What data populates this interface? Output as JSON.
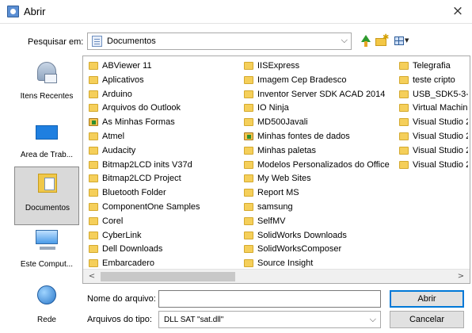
{
  "window": {
    "title": "Abrir",
    "close_glyph": "×",
    "icon": "java-app-icon"
  },
  "lookin": {
    "label": "Pesquisar em:",
    "value": "Documentos",
    "icon": "documents-folder-icon",
    "arrow": "⌵"
  },
  "toolbar": {
    "up_icon": "up-one-level-icon",
    "new_folder_icon": "new-folder-icon",
    "view_menu_icon": "view-menu-icon",
    "view_menu_arrow": "▼"
  },
  "places": [
    {
      "label": "Itens Recentes",
      "icon": "recent-items-icon",
      "selected": false
    },
    {
      "label": "Área de Trab...",
      "icon": "desktop-icon",
      "selected": false
    },
    {
      "label": "Documentos",
      "icon": "documents-icon",
      "selected": true
    },
    {
      "label": "Este Comput...",
      "icon": "computer-icon",
      "selected": false
    },
    {
      "label": "Rede",
      "icon": "network-icon",
      "selected": false
    }
  ],
  "files": {
    "columns": [
      [
        "ABViewer 11",
        "Aplicativos",
        "Arduino",
        "Arquivos do Outlook",
        "As Minhas Formas",
        "Atmel",
        "Audacity",
        "Bitmap2LCD inits V37d",
        "Bitmap2LCD Project",
        "Bluetooth Folder",
        "ComponentOne Samples",
        "Corel",
        "CyberLink",
        "Dell Downloads",
        "Embarcadero"
      ],
      [
        "IISExpress",
        "Imagem Cep Bradesco",
        "Inventor Server SDK ACAD 2014",
        "IO Ninja",
        "MD500Javali",
        "Minhas fontes de dados",
        "Minhas paletas",
        "Modelos Personalizados do Office",
        "My Web Sites",
        "Report MS",
        "samsung",
        "SelfMV",
        "SolidWorks Downloads",
        "SolidWorksComposer",
        "Source Insight"
      ],
      [
        "Telegrafia",
        "teste cripto",
        "USB_SDK5-3-1",
        "Virtual Machin",
        "Visual Studio 2",
        "Visual Studio 2",
        "Visual Studio 2",
        "Visual Studio 2"
      ]
    ],
    "special_items": [
      "As Minhas Formas",
      "Minhas fontes de dados"
    ]
  },
  "scroll": {
    "left_glyph": "<",
    "right_glyph": ">"
  },
  "filename": {
    "label": "Nome do arquivo:",
    "value": ""
  },
  "filetype": {
    "label": "Arquivos do tipo:",
    "value": "DLL SAT \"sat.dll\"",
    "arrow": "⌵"
  },
  "buttons": {
    "open": "Abrir",
    "cancel": "Cancelar"
  }
}
